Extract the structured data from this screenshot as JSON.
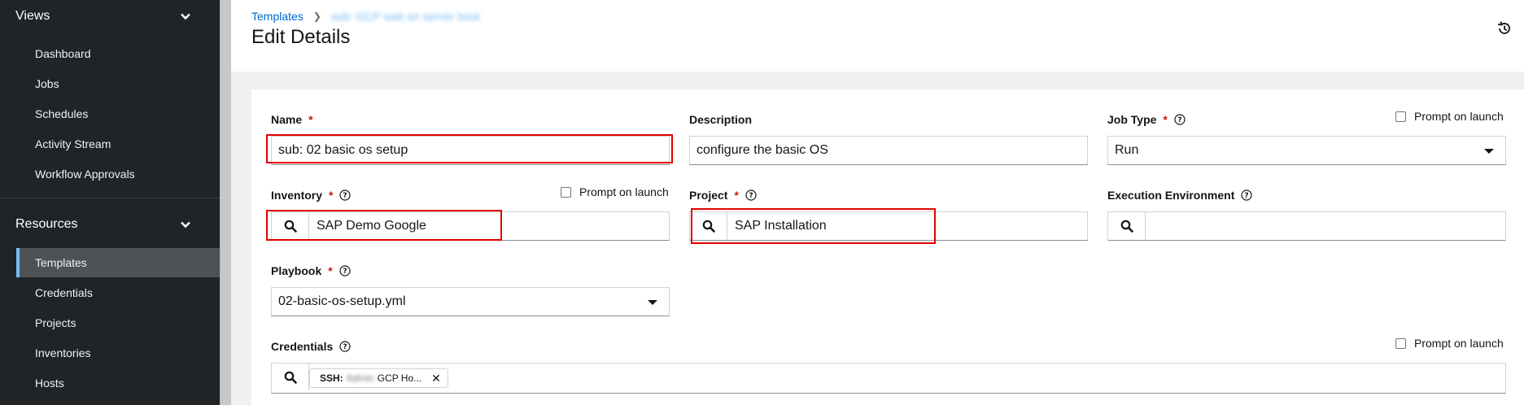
{
  "sidebar": {
    "views_title": "Views",
    "views_items": [
      "Dashboard",
      "Jobs",
      "Schedules",
      "Activity Stream",
      "Workflow Approvals"
    ],
    "resources_title": "Resources",
    "resources_items": [
      "Templates",
      "Credentials",
      "Projects",
      "Inventories",
      "Hosts"
    ],
    "active_item": "Templates"
  },
  "header": {
    "breadcrumb_root": "Templates",
    "breadcrumb_current": "sub: GCP wait on server boot",
    "title": "Edit Details"
  },
  "form": {
    "name": {
      "label": "Name",
      "value": "sub: 02 basic os setup"
    },
    "description": {
      "label": "Description",
      "value": "configure the basic OS"
    },
    "job_type": {
      "label": "Job Type",
      "value": "Run",
      "prompt": "Prompt on launch"
    },
    "inventory": {
      "label": "Inventory",
      "value": "SAP Demo Google",
      "prompt": "Prompt on launch"
    },
    "project": {
      "label": "Project",
      "value": "SAP Installation"
    },
    "execution_environment": {
      "label": "Execution Environment",
      "value": ""
    },
    "playbook": {
      "label": "Playbook",
      "value": "02-basic-os-setup.yml"
    },
    "credentials": {
      "label": "Credentials",
      "prompt": "Prompt on launch",
      "chip_prefix": "SSH:",
      "chip_blurred": "Admin",
      "chip_text": "GCP Ho..."
    }
  },
  "colors": {
    "sidebar_bg": "#212427",
    "active_bg": "#4f5255",
    "active_accent": "#73bcf7",
    "link": "#06c",
    "required": "#c9190b",
    "highlight": "#e00000"
  }
}
